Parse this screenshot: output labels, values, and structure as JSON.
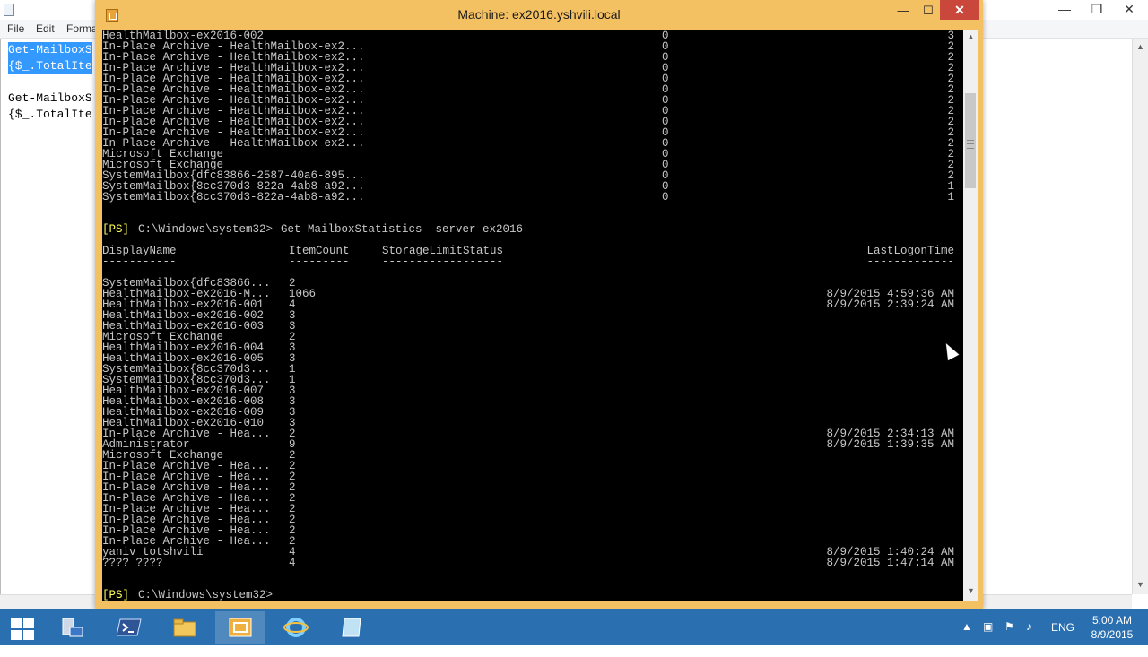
{
  "notepad": {
    "menu": [
      "File",
      "Edit",
      "Forma"
    ],
    "lines": [
      {
        "text": "Get-MailboxS",
        "selected": true
      },
      {
        "text": "{$_.TotalIte",
        "selected": true
      },
      {
        "text": "",
        "selected": false
      },
      {
        "text": "Get-MailboxS",
        "selected": false
      },
      {
        "text": "{$_.TotalIte",
        "selected": false
      }
    ]
  },
  "vm": {
    "title": "Machine: ex2016.yshvili.local",
    "minimize": "—",
    "maximize": "☐",
    "close": "✕"
  },
  "console": {
    "top_rows": [
      {
        "name": "HealthMailbox-ex2016-002",
        "mid": "0",
        "right": "3"
      },
      {
        "name": "In-Place Archive - HealthMailbox-ex2...",
        "mid": "0",
        "right": "2"
      },
      {
        "name": "In-Place Archive - HealthMailbox-ex2...",
        "mid": "0",
        "right": "2"
      },
      {
        "name": "In-Place Archive - HealthMailbox-ex2...",
        "mid": "0",
        "right": "2"
      },
      {
        "name": "In-Place Archive - HealthMailbox-ex2...",
        "mid": "0",
        "right": "2"
      },
      {
        "name": "In-Place Archive - HealthMailbox-ex2...",
        "mid": "0",
        "right": "2"
      },
      {
        "name": "In-Place Archive - HealthMailbox-ex2...",
        "mid": "0",
        "right": "2"
      },
      {
        "name": "In-Place Archive - HealthMailbox-ex2...",
        "mid": "0",
        "right": "2"
      },
      {
        "name": "In-Place Archive - HealthMailbox-ex2...",
        "mid": "0",
        "right": "2"
      },
      {
        "name": "In-Place Archive - HealthMailbox-ex2...",
        "mid": "0",
        "right": "2"
      },
      {
        "name": "In-Place Archive - HealthMailbox-ex2...",
        "mid": "0",
        "right": "2"
      },
      {
        "name": "Microsoft Exchange",
        "mid": "0",
        "right": "2"
      },
      {
        "name": "Microsoft Exchange",
        "mid": "0",
        "right": "2"
      },
      {
        "name": "SystemMailbox{dfc83866-2587-40a6-895...",
        "mid": "0",
        "right": "2"
      },
      {
        "name": "SystemMailbox{8cc370d3-822a-4ab8-a92...",
        "mid": "0",
        "right": "1"
      },
      {
        "name": "SystemMailbox{8cc370d3-822a-4ab8-a92...",
        "mid": "0",
        "right": "1"
      }
    ],
    "prompt_tag": "[PS]",
    "path": "C:\\Windows\\system32>",
    "command": "Get-MailboxStatistics -server ex2016",
    "headers": {
      "display_name": "DisplayName",
      "item_count": "ItemCount",
      "storage": "StorageLimitStatus",
      "last_logon": "LastLogonTime",
      "u_display_name": "-----------",
      "u_item_count": "---------",
      "u_storage": "------------------",
      "u_last_logon": "-------------"
    },
    "rows": [
      {
        "name": "SystemMailbox{dfc83866...",
        "count": "2",
        "logon": ""
      },
      {
        "name": "HealthMailbox-ex2016-M...",
        "count": "1066",
        "logon": "8/9/2015 4:59:36 AM"
      },
      {
        "name": "HealthMailbox-ex2016-001",
        "count": "4",
        "logon": "8/9/2015 2:39:24 AM"
      },
      {
        "name": "HealthMailbox-ex2016-002",
        "count": "3",
        "logon": ""
      },
      {
        "name": "HealthMailbox-ex2016-003",
        "count": "3",
        "logon": ""
      },
      {
        "name": "Microsoft Exchange",
        "count": "2",
        "logon": ""
      },
      {
        "name": "HealthMailbox-ex2016-004",
        "count": "3",
        "logon": ""
      },
      {
        "name": "HealthMailbox-ex2016-005",
        "count": "3",
        "logon": ""
      },
      {
        "name": "SystemMailbox{8cc370d3...",
        "count": "1",
        "logon": ""
      },
      {
        "name": "SystemMailbox{8cc370d3...",
        "count": "1",
        "logon": ""
      },
      {
        "name": "HealthMailbox-ex2016-007",
        "count": "3",
        "logon": ""
      },
      {
        "name": "HealthMailbox-ex2016-008",
        "count": "3",
        "logon": ""
      },
      {
        "name": "HealthMailbox-ex2016-009",
        "count": "3",
        "logon": ""
      },
      {
        "name": "HealthMailbox-ex2016-010",
        "count": "3",
        "logon": ""
      },
      {
        "name": "In-Place Archive - Hea...",
        "count": "2",
        "logon": "8/9/2015 2:34:13 AM"
      },
      {
        "name": "Administrator",
        "count": "9",
        "logon": "8/9/2015 1:39:35 AM"
      },
      {
        "name": "Microsoft Exchange",
        "count": "2",
        "logon": ""
      },
      {
        "name": "In-Place Archive - Hea...",
        "count": "2",
        "logon": ""
      },
      {
        "name": "In-Place Archive - Hea...",
        "count": "2",
        "logon": ""
      },
      {
        "name": "In-Place Archive - Hea...",
        "count": "2",
        "logon": ""
      },
      {
        "name": "In-Place Archive - Hea...",
        "count": "2",
        "logon": ""
      },
      {
        "name": "In-Place Archive - Hea...",
        "count": "2",
        "logon": ""
      },
      {
        "name": "In-Place Archive - Hea...",
        "count": "2",
        "logon": ""
      },
      {
        "name": "In-Place Archive - Hea...",
        "count": "2",
        "logon": ""
      },
      {
        "name": "In-Place Archive - Hea...",
        "count": "2",
        "logon": ""
      },
      {
        "name": "yaniv totshvili",
        "count": "4",
        "logon": "8/9/2015 1:40:24 AM"
      },
      {
        "name": "???? ????",
        "count": "4",
        "logon": "8/9/2015 1:47:14 AM"
      }
    ]
  },
  "taskbar": {
    "items": [
      "start-icon",
      "server-manager-icon",
      "powershell-icon",
      "file-explorer-icon",
      "hyper-v-connect-icon",
      "internet-explorer-icon",
      "notepad-icon"
    ],
    "language": "ENG",
    "time": "5:00 AM",
    "date": "8/9/2015"
  },
  "colors": {
    "vm_frame": "#f4c162",
    "console_bg": "#000000",
    "console_text": "#c8c8c8",
    "prompt": "#ffff55",
    "taskbar": "#2a6fb0",
    "selection": "#3399ff"
  }
}
